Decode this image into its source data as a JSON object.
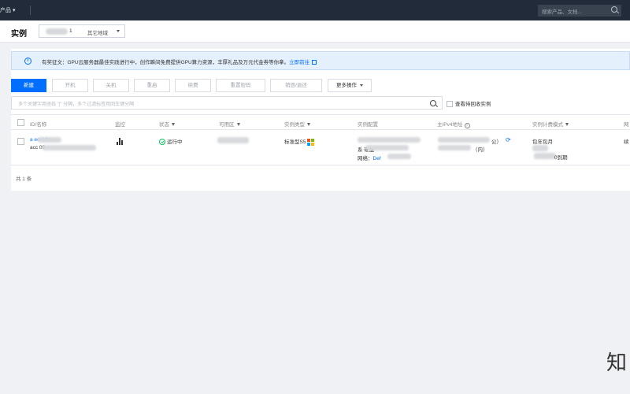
{
  "topbar": {
    "products_label": "产品",
    "search_placeholder": "搜索产品、文档..."
  },
  "header": {
    "title": "实例",
    "region_number": "1",
    "region_other": "其它地域"
  },
  "notice": {
    "text": "有奖征文：GPU云服务器最佳实践进行中，创作瞬间免费提供GPU算力资源，丰厚礼品及万元代金券等你拿。",
    "link": "立即前往"
  },
  "toolbar": {
    "buttons": [
      "新建",
      "开机",
      "关机",
      "重启",
      "续费",
      "重置密码",
      "销毁/退还"
    ],
    "more": "更多操作"
  },
  "filter": {
    "placeholder": "多个关键字用竖线 \"|\" 分隔，多个过滤标签用回车键分隔",
    "recycle_label": "查看待回收实例"
  },
  "table": {
    "columns": [
      "ID/名称",
      "监控",
      "状态",
      "可用区",
      "实例类型",
      "实例配置",
      "主IPv4地址",
      "实例计费模式",
      "网"
    ],
    "row": {
      "id_partial": "a        eoak1z",
      "name_partial": "acc                   09",
      "status": "运行中",
      "type": "标准型S5",
      "config_partial": "系               硬盘",
      "network_label": "网络：",
      "network_value": "Def",
      "ip_public": "公）",
      "ip_private": "（内）",
      "billing": "包年包月",
      "billing_expire": "0到期",
      "next": "续"
    },
    "footer": "共 1 条"
  },
  "colors": {
    "accent": "#006eff",
    "topbar": "#212b3a",
    "running": "#0abf5b"
  },
  "watermark": "知"
}
